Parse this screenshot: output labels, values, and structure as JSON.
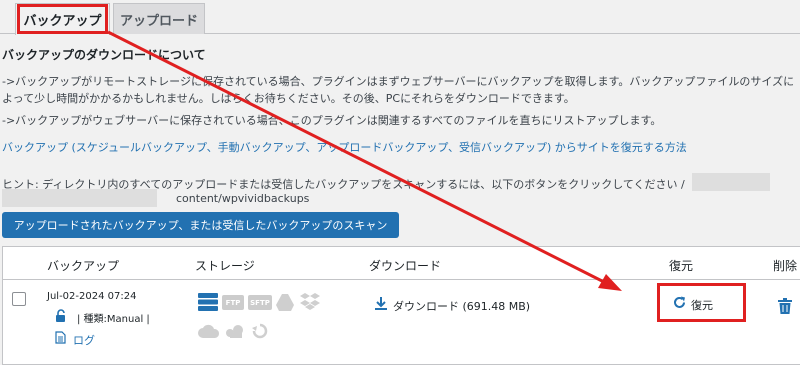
{
  "tabs": [
    {
      "label": "バックアップ",
      "active": true
    },
    {
      "label": "アップロード",
      "active": false
    }
  ],
  "section": {
    "heading": "バックアップのダウンロードについて",
    "line1": "->バックアップがリモートストレージに保存されている場合、プラグインはまずウェブサーバーにバックアップを取得します。バックアップファイルのサイズに",
    "line2": "よって少し時間がかかるかもしれません。しばらくお待ちください。その後、PCにそれらをダウンロードできます。",
    "line3": "->バックアップがウェブサーバーに保存されている場合、このプラグインは関連するすべてのファイルを直ちにリストアップします。",
    "link": "バックアップ (スケジュールバックアップ、手動バックアップ、アップロードバックアップ、受信バックアップ) からサイトを復元する方法",
    "hint": "ヒント: ディレクトリ内のすべてのアップロードまたは受信したバックアップをスキャンするには、以下のボタンをクリックしてください /",
    "hint_path": "content/wpvividbackups",
    "scan_button": "アップロードされたバックアップ、または受信したバックアップのスキャン"
  },
  "table": {
    "headers": {
      "backup": "バックアップ",
      "storage": "ストレージ",
      "download": "ダウンロード",
      "restore": "復元",
      "delete": "削除"
    },
    "row": {
      "date": "Jul-02-2024 07:24",
      "type": "| 種類:Manual |",
      "log": "ログ",
      "storage_icons": [
        "server-icon",
        "ftp-icon",
        "sftp-icon",
        "google-drive-icon",
        "dropbox-icon",
        "onedrive-icon",
        "cloud-icon",
        "sync-icon"
      ],
      "storage_ftp": "FTP",
      "storage_sftp": "SFTP",
      "download": "ダウンロード (691.48 MB)",
      "restore": "復元"
    }
  },
  "colors": {
    "accent": "#2271b1",
    "annotation": "#e02020"
  }
}
